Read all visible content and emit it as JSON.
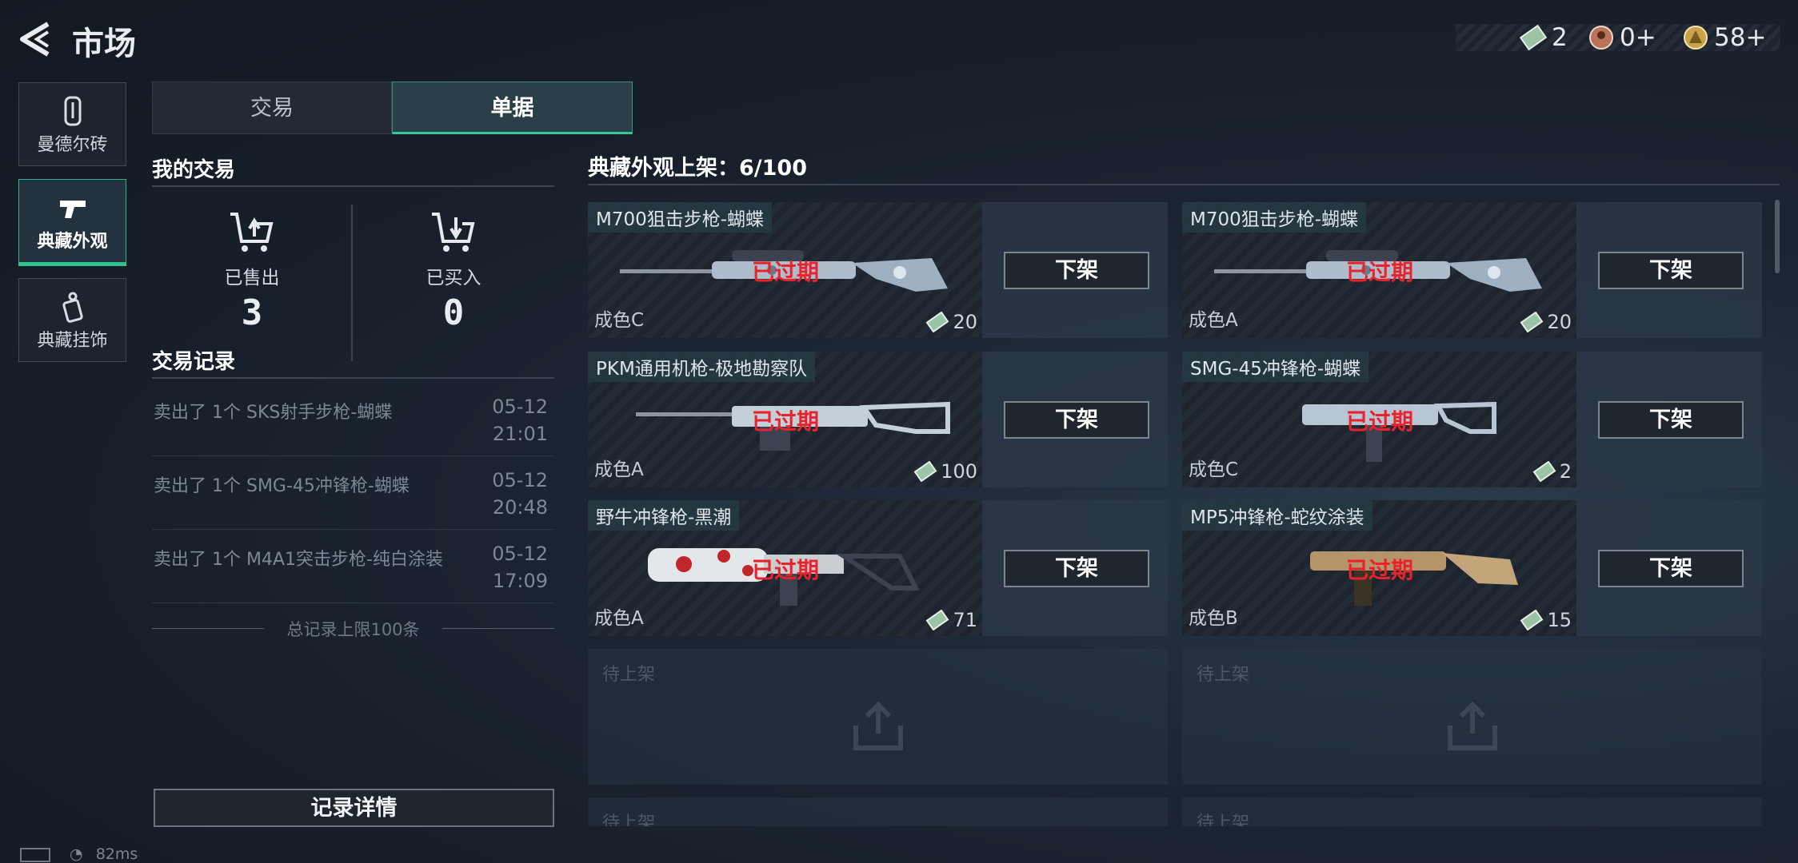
{
  "header": {
    "title": "市场"
  },
  "currency": [
    {
      "icon": "ticket-icon",
      "value": "2"
    },
    {
      "icon": "medal-icon",
      "value": "0+"
    },
    {
      "icon": "coin-icon",
      "value": "58+"
    }
  ],
  "sidebar": {
    "items": [
      {
        "label": "曼德尔砖",
        "icon": "brick-icon"
      },
      {
        "label": "典藏外观",
        "icon": "pistol-icon"
      },
      {
        "label": "典藏挂饰",
        "icon": "charm-icon"
      }
    ]
  },
  "tabs": [
    "交易",
    "单据"
  ],
  "my_trades": {
    "title": "我的交易",
    "sold": {
      "label": "已售出",
      "value": "3"
    },
    "bought": {
      "label": "已买入",
      "value": "0"
    }
  },
  "records": {
    "title": "交易记录",
    "items": [
      {
        "text": "卖出了 1个 SKS射手步枪-蝴蝶",
        "date": "05-12",
        "time": "21:01"
      },
      {
        "text": "卖出了 1个 SMG-45冲锋枪-蝴蝶",
        "date": "05-12",
        "time": "20:48"
      },
      {
        "text": "卖出了 1个 M4A1突击步枪-纯白涂装",
        "date": "05-12",
        "time": "17:09"
      }
    ],
    "limit": "总记录上限100条",
    "details_button": "记录详情"
  },
  "shelf": {
    "title": "典藏外观上架：6/100",
    "remove_label": "下架",
    "expired_label": "已过期",
    "empty_label": "待上架",
    "cards": [
      {
        "name": "M700狙击步枪-蝴蝶",
        "condition": "成色C",
        "price": "20"
      },
      {
        "name": "M700狙击步枪-蝴蝶",
        "condition": "成色A",
        "price": "20"
      },
      {
        "name": "PKM通用机枪-极地勘察队",
        "condition": "成色A",
        "price": "100"
      },
      {
        "name": "SMG-45冲锋枪-蝴蝶",
        "condition": "成色C",
        "price": "2"
      },
      {
        "name": "野牛冲锋枪-黑潮",
        "condition": "成色A",
        "price": "71"
      },
      {
        "name": "MP5冲锋枪-蛇纹涂装",
        "condition": "成色B",
        "price": "15"
      }
    ]
  },
  "footer": {
    "ping": "82ms"
  },
  "colors": {
    "accent": "#36c895",
    "expired": "#e8232b"
  }
}
